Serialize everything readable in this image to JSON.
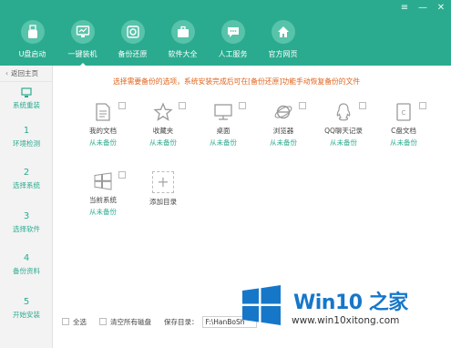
{
  "window_controls": {
    "menu": "≡",
    "minimize": "—",
    "close": "✕"
  },
  "nav": {
    "items": [
      {
        "label": "U盘启动",
        "icon": "usb-icon"
      },
      {
        "label": "一键装机",
        "icon": "monitor-icon",
        "active": true
      },
      {
        "label": "备份还原",
        "icon": "backup-icon"
      },
      {
        "label": "软件大全",
        "icon": "briefcase-icon"
      },
      {
        "label": "人工服务",
        "icon": "chat-icon"
      },
      {
        "label": "官方网页",
        "icon": "home-icon"
      }
    ]
  },
  "sidebar": {
    "back_label": "返回主页",
    "steps": [
      {
        "num": "",
        "label": "系统重装",
        "icon": "system-icon"
      },
      {
        "num": "1",
        "label": "环境检测"
      },
      {
        "num": "2",
        "label": "选择系统"
      },
      {
        "num": "3",
        "label": "选择软件"
      },
      {
        "num": "4",
        "label": "备份资料"
      },
      {
        "num": "5",
        "label": "开始安装"
      }
    ]
  },
  "content": {
    "info_text": "选择需要备份的选项，系统安装完成后可在[备份还原]功能手动恢复备份的文件",
    "items": [
      {
        "name": "我的文档",
        "status": "从未备份",
        "icon": "document-icon"
      },
      {
        "name": "收藏夹",
        "status": "从未备份",
        "icon": "star-icon"
      },
      {
        "name": "桌面",
        "status": "从未备份",
        "icon": "desktop-icon"
      },
      {
        "name": "浏览器",
        "status": "从未备份",
        "icon": "ie-icon"
      },
      {
        "name": "QQ聊天记录",
        "status": "从未备份",
        "icon": "qq-icon"
      },
      {
        "name": "C盘文档",
        "status": "从未备份",
        "icon": "drive-icon"
      },
      {
        "name": "当前系统",
        "status": "从未备份",
        "icon": "windows-icon"
      },
      {
        "name": "添加目录",
        "status": "",
        "icon": "plus-icon"
      }
    ]
  },
  "footer": {
    "select_all": "全选",
    "clear_disks": "清空所有磁盘",
    "save_dir_label": "保存目录：",
    "save_dir_value": "F:\\HanBoSh"
  },
  "watermark": {
    "title": "Win10 之家",
    "url": "www.win10xitong.com"
  },
  "colors": {
    "header": "#2aab8f",
    "accent": "#2aab8f",
    "info": "#e0621a",
    "watermark_blue": "#1677c9"
  }
}
